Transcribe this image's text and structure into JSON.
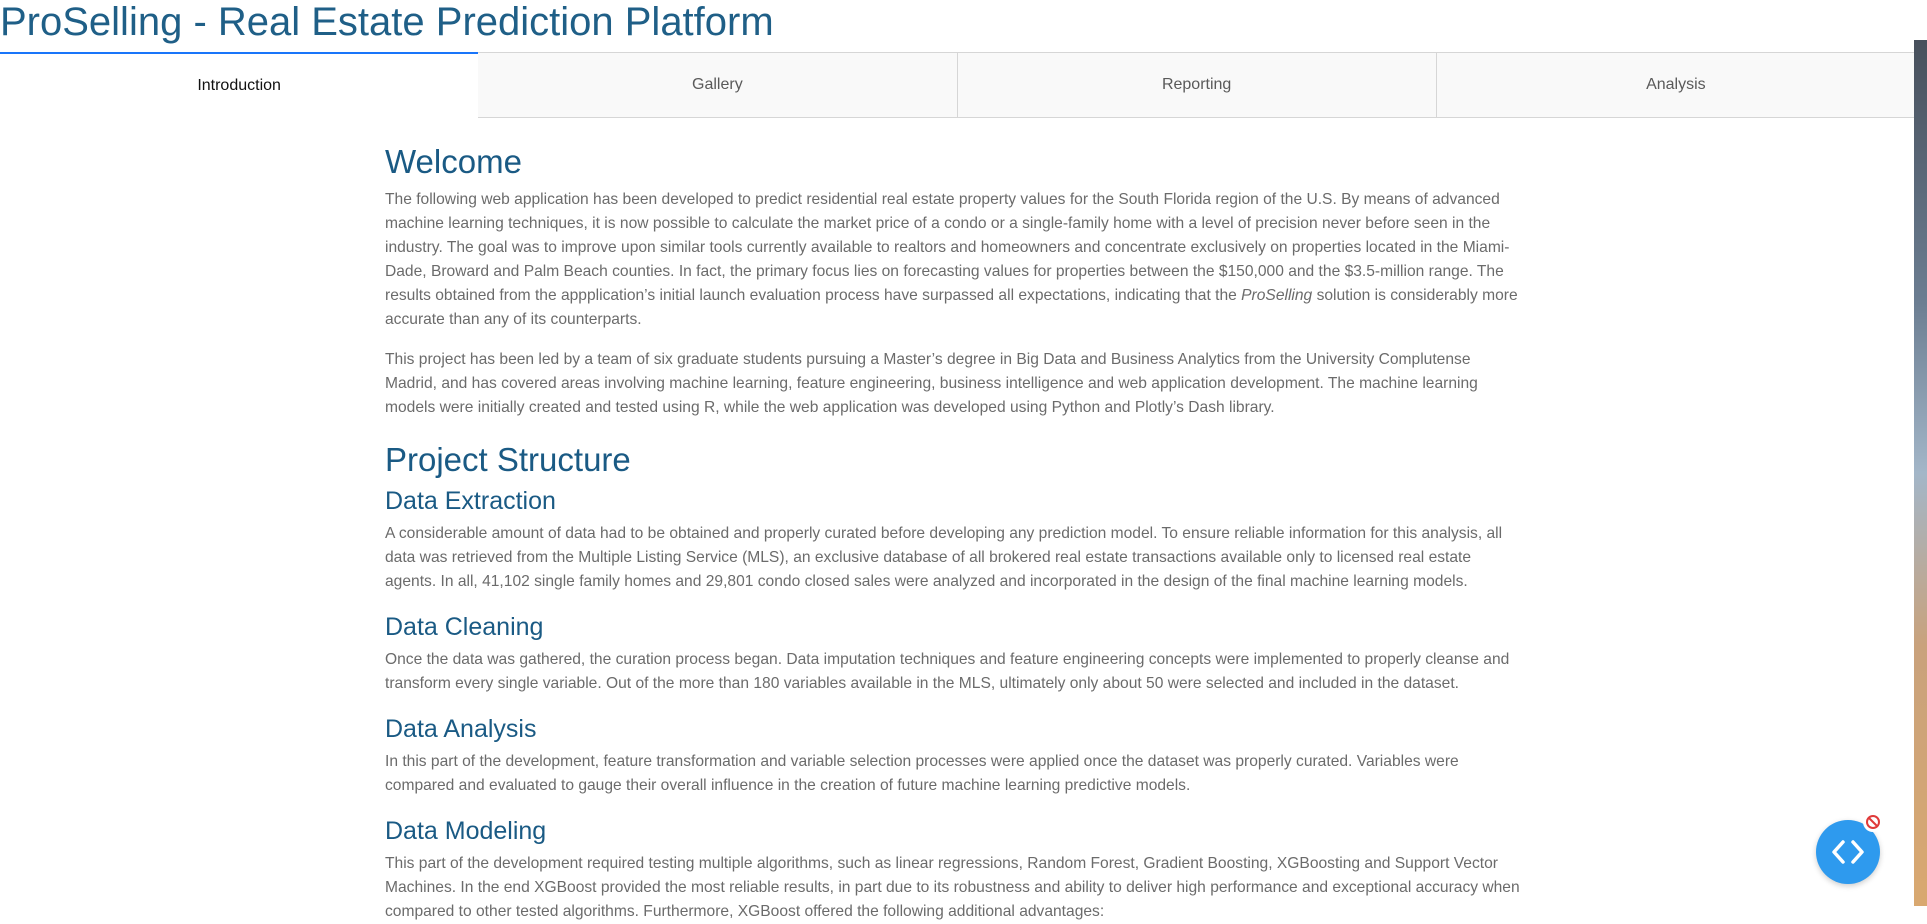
{
  "app": {
    "title": "ProSelling - Real Estate Prediction Platform"
  },
  "tabs": [
    {
      "label": "Introduction",
      "selected": true
    },
    {
      "label": "Gallery",
      "selected": false
    },
    {
      "label": "Reporting",
      "selected": false
    },
    {
      "label": "Analysis",
      "selected": false
    }
  ],
  "content": {
    "welcome": {
      "heading": "Welcome",
      "p1_before": "The following web application has been developed to predict residential real estate property values for the South Florida region of the U.S. By means of advanced machine learning techniques, it is now possible to calculate the market price of a condo or a single-family home with a level of precision never before seen in the industry. The goal was to improve upon similar tools currently available to realtors and homeowners and concentrate exclusively on properties located in the Miami-Dade, Broward and Palm Beach counties. In fact, the primary focus lies on forecasting values for properties between the $150,000 and the $3.5-million range. The results obtained from the appplication’s initial launch evaluation process have surpassed all expectations, indicating that the ",
      "p1_em": "ProSelling",
      "p1_after": " solution is considerably more accurate than any of its counterparts.",
      "p2": "This project has been led by a team of six graduate students pursuing a Master’s degree in Big Data and Business Analytics from the University Complutense Madrid, and has covered areas involving machine learning, feature engineering, business intelligence and web application development. The machine learning models were initially created and tested using R, while the web application was developed using Python and Plotly’s Dash library."
    },
    "structure": {
      "heading": "Project Structure",
      "sections": [
        {
          "title": "Data Extraction",
          "text": "A considerable amount of data had to be obtained and properly curated before developing any prediction model. To ensure reliable information for this analysis, all data was retrieved from the Multiple Listing Service (MLS), an exclusive database of all brokered real estate transactions available only to licensed real estate agents. In all, 41,102 single family homes and 29,801 condo closed sales were analyzed and incorporated in the design of the final machine learning models."
        },
        {
          "title": "Data Cleaning",
          "text": "Once the data was gathered, the curation process began. Data imputation techniques and feature engineering concepts were implemented to properly cleanse and transform every single variable. Out of the more than 180 variables available in the MLS, ultimately only about 50 were selected and included in the dataset."
        },
        {
          "title": "Data Analysis",
          "text": "In this part of the development, feature transformation and variable selection processes were applied once the dataset was properly curated. Variables were compared and evaluated to gauge their overall influence in the creation of future machine learning predictive models."
        },
        {
          "title": "Data Modeling",
          "text": "This part of the development required testing multiple algorithms, such as linear regressions, Random Forest, Gradient Boosting, XGBoosting and Support Vector Machines. In the end XGBoost provided the most reliable results, in part due to its robustness and ability to deliver high performance and exceptional accuracy when compared to other tested algorithms. Furthermore, XGBoost offered the following additional advantages:"
        }
      ]
    }
  },
  "icons": {
    "floating_button": "code-brackets-icon",
    "badge": "blocked-icon"
  },
  "colors": {
    "heading": "#1a5a84",
    "tab_accent": "#1975fa",
    "floating_button": "#2e9aee",
    "body_text": "#6b6b6b"
  }
}
